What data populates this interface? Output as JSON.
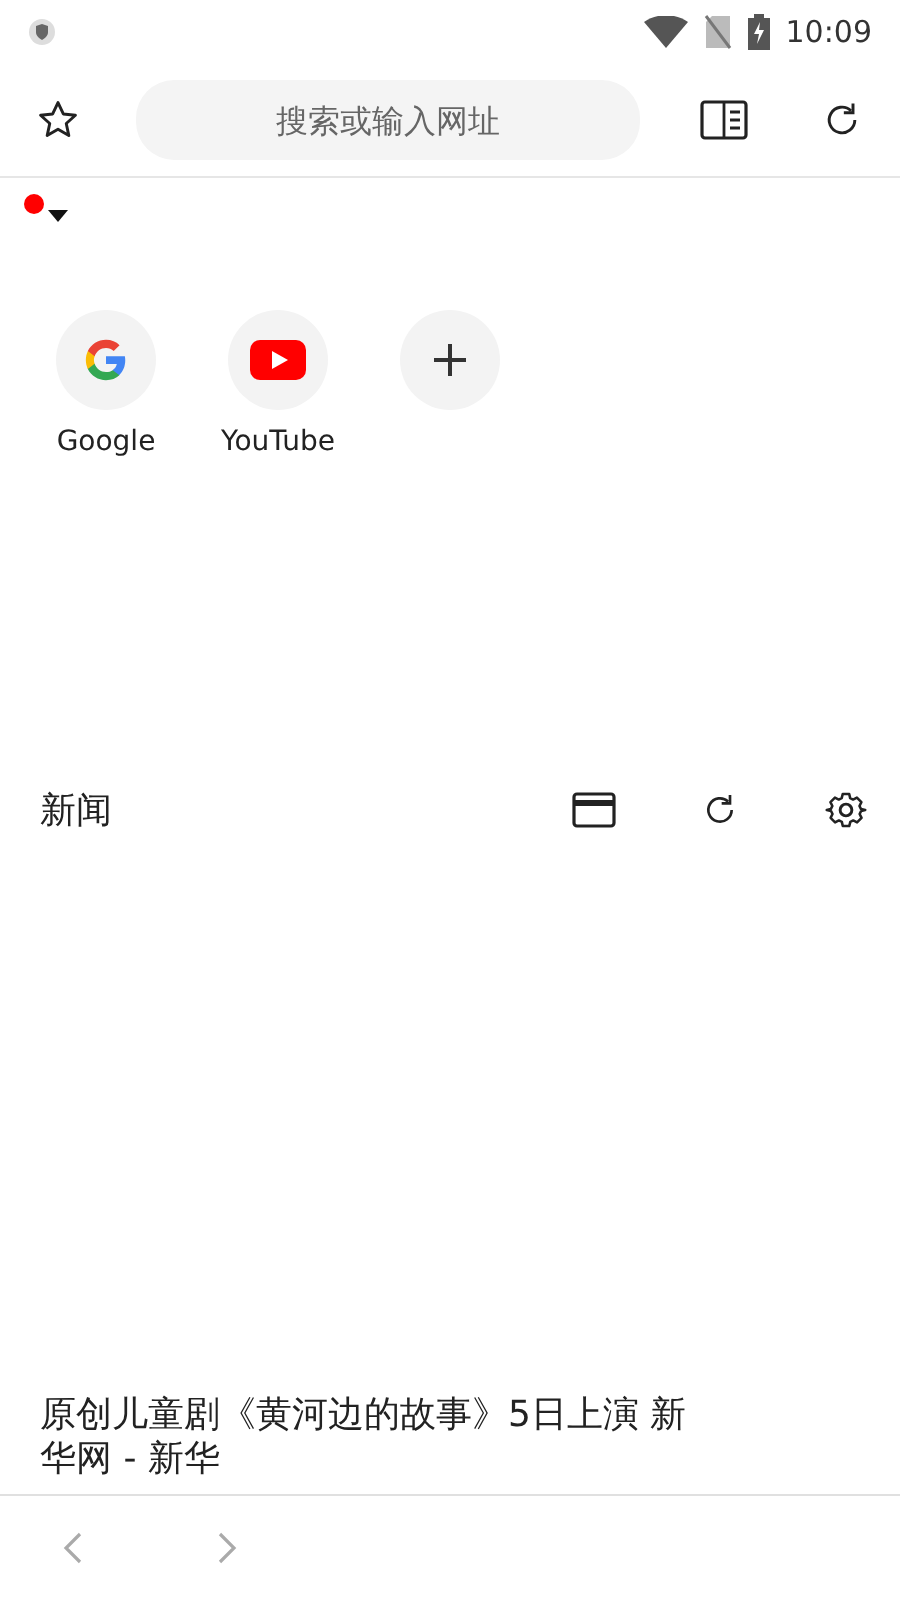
{
  "status_bar": {
    "time": "10:09"
  },
  "toolbar": {
    "search": {
      "placeholder": "搜索或输入网址"
    }
  },
  "notification_dot": {
    "color": "#ff0000"
  },
  "shortcuts": [
    {
      "kind": "google",
      "label": "Google"
    },
    {
      "kind": "youtube",
      "label": "YouTube"
    },
    {
      "kind": "add"
    }
  ],
  "news": {
    "title": "新闻",
    "headline_lines": [
      "原创儿童剧《黄河边的故事》5日上演 新",
      "华网 - 新华"
    ]
  }
}
